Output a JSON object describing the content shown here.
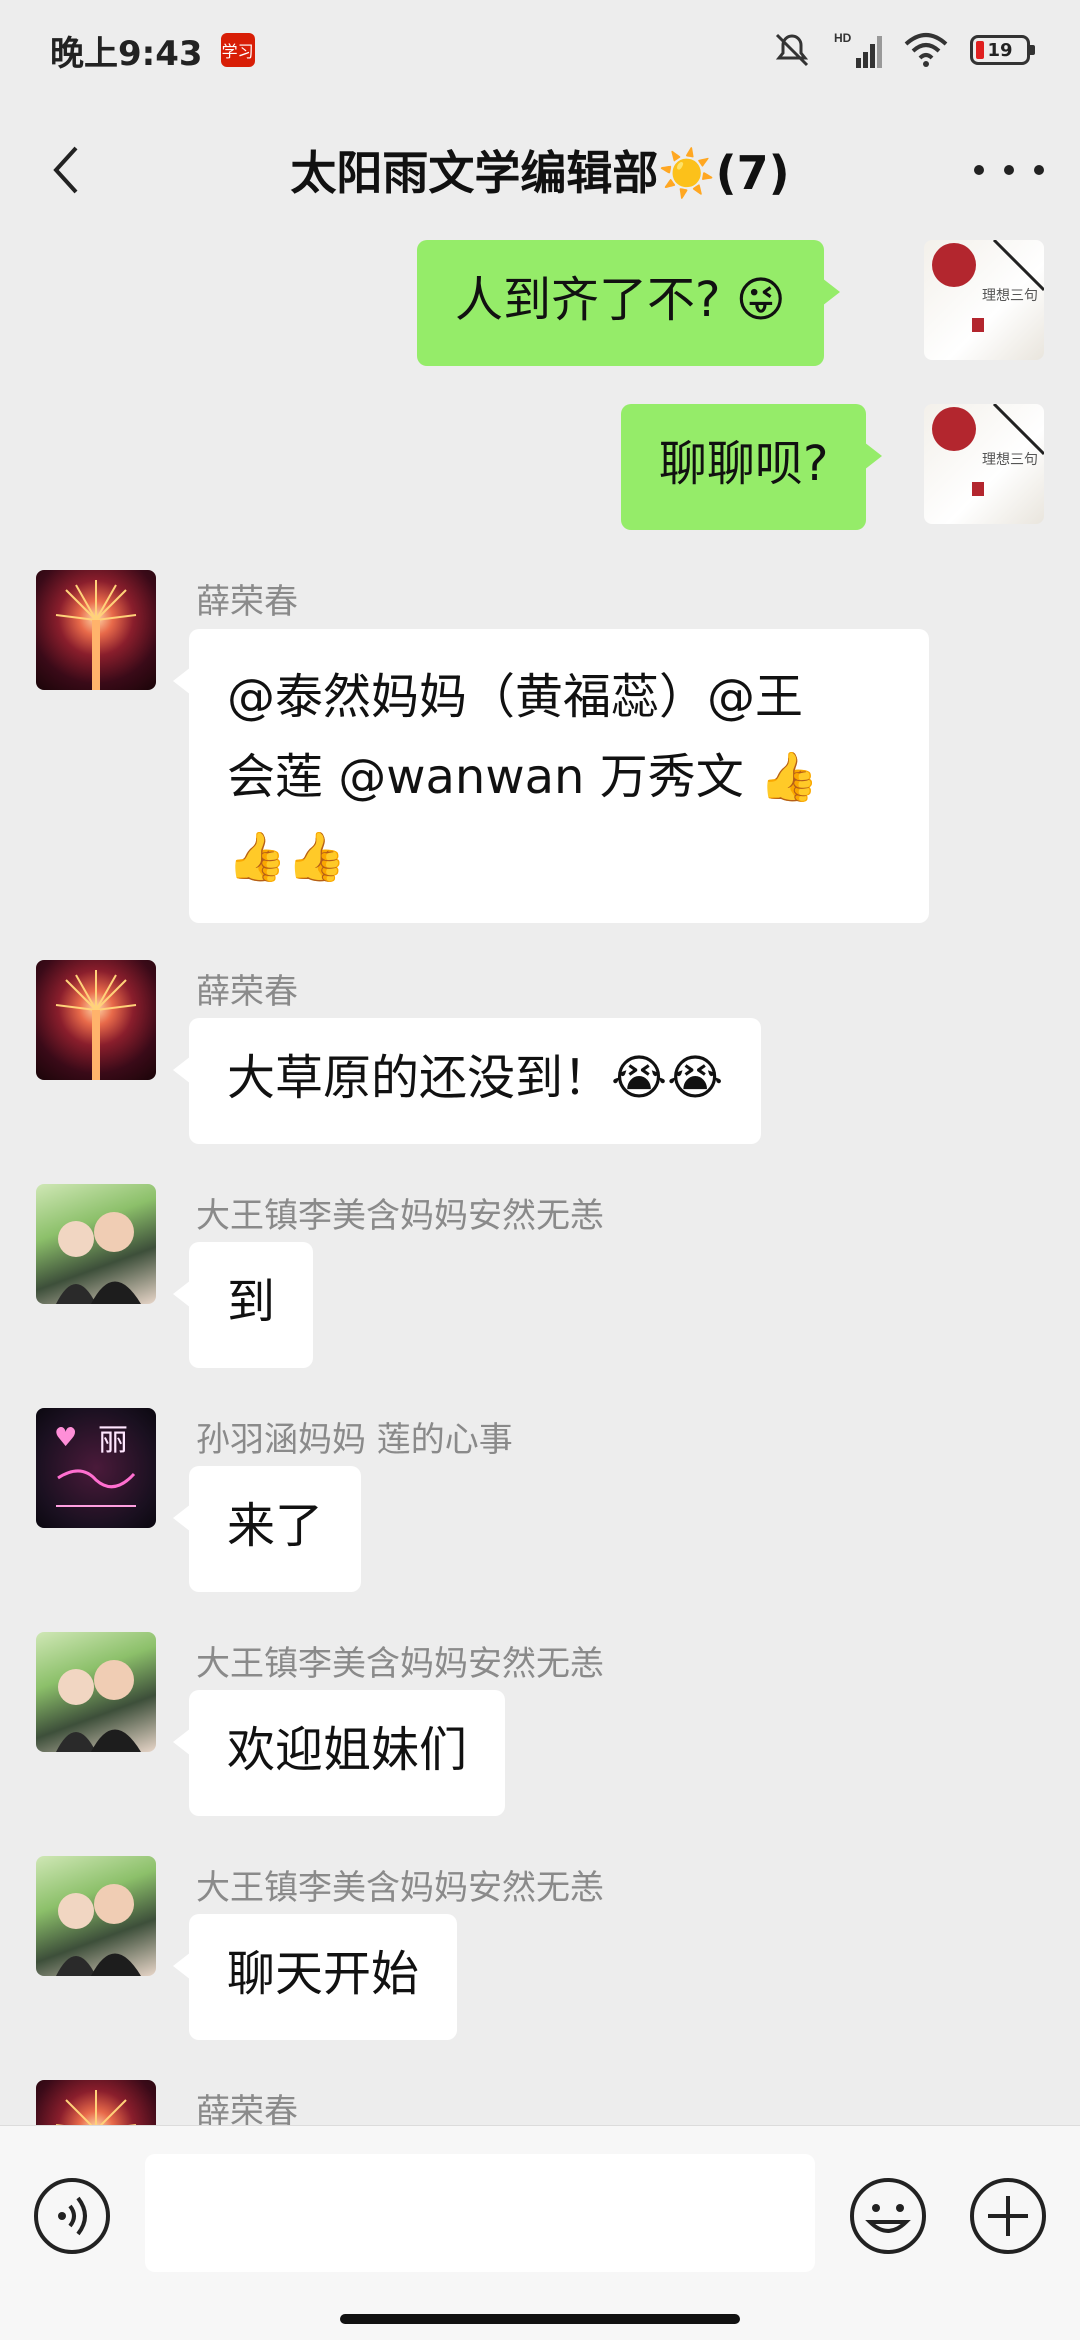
{
  "status_bar": {
    "time": "晚上9:43",
    "app_badge": "学习",
    "battery": "19",
    "network": "HD"
  },
  "header": {
    "title": "太阳雨文学编辑部☀️(7)"
  },
  "messages": [
    {
      "side": "me",
      "text": "人到齐了不? 😜"
    },
    {
      "side": "me",
      "text": "聊聊呗?"
    },
    {
      "side": "other",
      "sender": "薛荣春",
      "line1": "@泰然妈妈（黄福蕊）@王",
      "line2": "会莲 @wanwan 万秀文 👍",
      "line3": "👍👍"
    },
    {
      "side": "other",
      "sender": "薛荣春",
      "text": "大草原的还没到！😭😭"
    },
    {
      "side": "other",
      "sender": "大王镇李美含妈妈安然无恙",
      "text": "到"
    },
    {
      "side": "other",
      "sender": "孙羽涵妈妈  莲的心事",
      "text": "来了"
    },
    {
      "side": "other",
      "sender": "大王镇李美含妈妈安然无恙",
      "text": "欢迎姐妹们"
    },
    {
      "side": "other",
      "sender": "大王镇李美含妈妈安然无恙",
      "text": "聊天开始"
    },
    {
      "side": "other",
      "sender": "薛荣春",
      "text": ""
    }
  ],
  "avatar_art": {
    "self_caption": "理想三句",
    "neon_caption": "丽"
  },
  "colors": {
    "my_bubble": "#95ec69",
    "other_bubble": "#ffffff",
    "background": "#ededed"
  },
  "input_bar": {
    "value": ""
  },
  "icons": [
    "back-arrow-icon",
    "more-icon",
    "voice-icon",
    "emoji-icon",
    "plus-icon",
    "mute-icon",
    "signal-icon",
    "wifi-icon",
    "battery-icon"
  ]
}
